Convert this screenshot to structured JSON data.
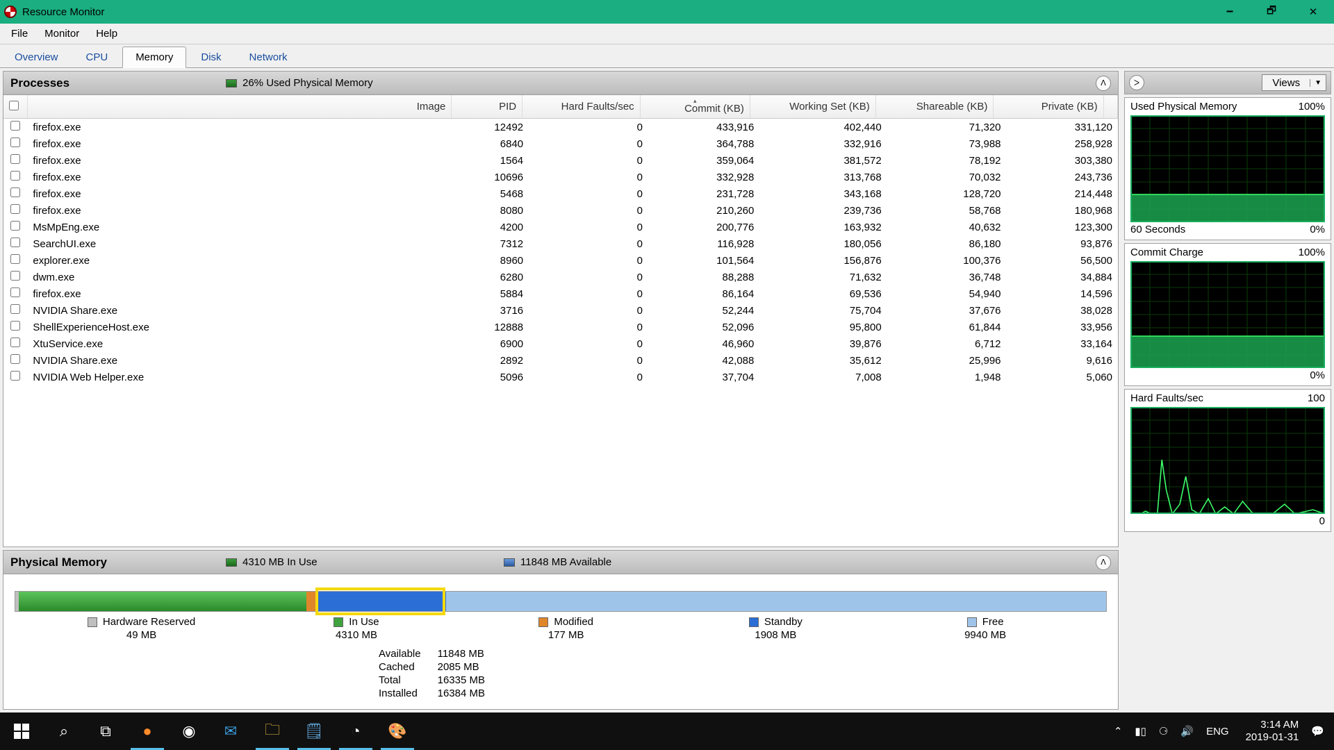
{
  "window": {
    "title": "Resource Monitor"
  },
  "menu": {
    "file": "File",
    "monitor": "Monitor",
    "help": "Help"
  },
  "tabs": {
    "overview": "Overview",
    "cpu": "CPU",
    "memory": "Memory",
    "disk": "Disk",
    "network": "Network",
    "active": "Memory"
  },
  "processes": {
    "title": "Processes",
    "summary": "26% Used Physical Memory",
    "columns": {
      "image": "Image",
      "pid": "PID",
      "hf": "Hard Faults/sec",
      "commit": "Commit (KB)",
      "ws": "Working Set (KB)",
      "share": "Shareable (KB)",
      "priv": "Private (KB)"
    },
    "rows": [
      {
        "image": "firefox.exe",
        "pid": "12492",
        "hf": "0",
        "commit": "433,916",
        "ws": "402,440",
        "share": "71,320",
        "priv": "331,120"
      },
      {
        "image": "firefox.exe",
        "pid": "6840",
        "hf": "0",
        "commit": "364,788",
        "ws": "332,916",
        "share": "73,988",
        "priv": "258,928"
      },
      {
        "image": "firefox.exe",
        "pid": "1564",
        "hf": "0",
        "commit": "359,064",
        "ws": "381,572",
        "share": "78,192",
        "priv": "303,380"
      },
      {
        "image": "firefox.exe",
        "pid": "10696",
        "hf": "0",
        "commit": "332,928",
        "ws": "313,768",
        "share": "70,032",
        "priv": "243,736"
      },
      {
        "image": "firefox.exe",
        "pid": "5468",
        "hf": "0",
        "commit": "231,728",
        "ws": "343,168",
        "share": "128,720",
        "priv": "214,448"
      },
      {
        "image": "firefox.exe",
        "pid": "8080",
        "hf": "0",
        "commit": "210,260",
        "ws": "239,736",
        "share": "58,768",
        "priv": "180,968"
      },
      {
        "image": "MsMpEng.exe",
        "pid": "4200",
        "hf": "0",
        "commit": "200,776",
        "ws": "163,932",
        "share": "40,632",
        "priv": "123,300"
      },
      {
        "image": "SearchUI.exe",
        "pid": "7312",
        "hf": "0",
        "commit": "116,928",
        "ws": "180,056",
        "share": "86,180",
        "priv": "93,876"
      },
      {
        "image": "explorer.exe",
        "pid": "8960",
        "hf": "0",
        "commit": "101,564",
        "ws": "156,876",
        "share": "100,376",
        "priv": "56,500"
      },
      {
        "image": "dwm.exe",
        "pid": "6280",
        "hf": "0",
        "commit": "88,288",
        "ws": "71,632",
        "share": "36,748",
        "priv": "34,884"
      },
      {
        "image": "firefox.exe",
        "pid": "5884",
        "hf": "0",
        "commit": "86,164",
        "ws": "69,536",
        "share": "54,940",
        "priv": "14,596"
      },
      {
        "image": "NVIDIA Share.exe",
        "pid": "3716",
        "hf": "0",
        "commit": "52,244",
        "ws": "75,704",
        "share": "37,676",
        "priv": "38,028"
      },
      {
        "image": "ShellExperienceHost.exe",
        "pid": "12888",
        "hf": "0",
        "commit": "52,096",
        "ws": "95,800",
        "share": "61,844",
        "priv": "33,956"
      },
      {
        "image": "XtuService.exe",
        "pid": "6900",
        "hf": "0",
        "commit": "46,960",
        "ws": "39,876",
        "share": "6,712",
        "priv": "33,164"
      },
      {
        "image": "NVIDIA Share.exe",
        "pid": "2892",
        "hf": "0",
        "commit": "42,088",
        "ws": "35,612",
        "share": "25,996",
        "priv": "9,616"
      },
      {
        "image": "NVIDIA Web Helper.exe",
        "pid": "5096",
        "hf": "0",
        "commit": "37,704",
        "ws": "7,008",
        "share": "1,948",
        "priv": "5,060"
      }
    ]
  },
  "physicalMemory": {
    "title": "Physical Memory",
    "inUseSummary": "4310 MB In Use",
    "availSummary": "11848 MB Available",
    "legend": {
      "hw": {
        "label": "Hardware Reserved",
        "val": "49 MB",
        "color": "#bfbfbf"
      },
      "inuse": {
        "label": "In Use",
        "val": "4310 MB",
        "color": "#3fa23f"
      },
      "mod": {
        "label": "Modified",
        "val": "177 MB",
        "color": "#e0862a"
      },
      "standby": {
        "label": "Standby",
        "val": "1908 MB",
        "color": "#2a6ed6"
      },
      "free": {
        "label": "Free",
        "val": "9940 MB",
        "color": "#9fc4ea"
      }
    },
    "stats": {
      "available": {
        "l": "Available",
        "v": "11848 MB"
      },
      "cached": {
        "l": "Cached",
        "v": "2085 MB"
      },
      "total": {
        "l": "Total",
        "v": "16335 MB"
      },
      "installed": {
        "l": "Installed",
        "v": "16384 MB"
      }
    }
  },
  "rightPane": {
    "views": "Views",
    "g1": {
      "title": "Used Physical Memory",
      "top": "100%",
      "botL": "60 Seconds",
      "botR": "0%"
    },
    "g2": {
      "title": "Commit Charge",
      "top": "100%",
      "botR": "0%"
    },
    "g3": {
      "title": "Hard Faults/sec",
      "top": "100",
      "botR": "0"
    }
  },
  "chart_data": [
    {
      "type": "area",
      "title": "Used Physical Memory",
      "xlabel": "60 Seconds",
      "ylabel": "%",
      "ylim": [
        0,
        100
      ],
      "approx_value": 26,
      "note": "flat ~26% over 60s"
    },
    {
      "type": "area",
      "title": "Commit Charge",
      "ylabel": "%",
      "ylim": [
        0,
        100
      ],
      "approx_value": 30,
      "note": "flat ~30% over 60s"
    },
    {
      "type": "line",
      "title": "Hard Faults/sec",
      "ylim": [
        0,
        100
      ],
      "approx_values": [
        0,
        0,
        2,
        0,
        0,
        50,
        20,
        0,
        10,
        35,
        5,
        0,
        15,
        0,
        8,
        0,
        12,
        0,
        0,
        10
      ],
      "note": "spiky low values"
    }
  ],
  "taskbar": {
    "lang": "ENG",
    "time": "3:14 AM",
    "date": "2019-01-31"
  }
}
